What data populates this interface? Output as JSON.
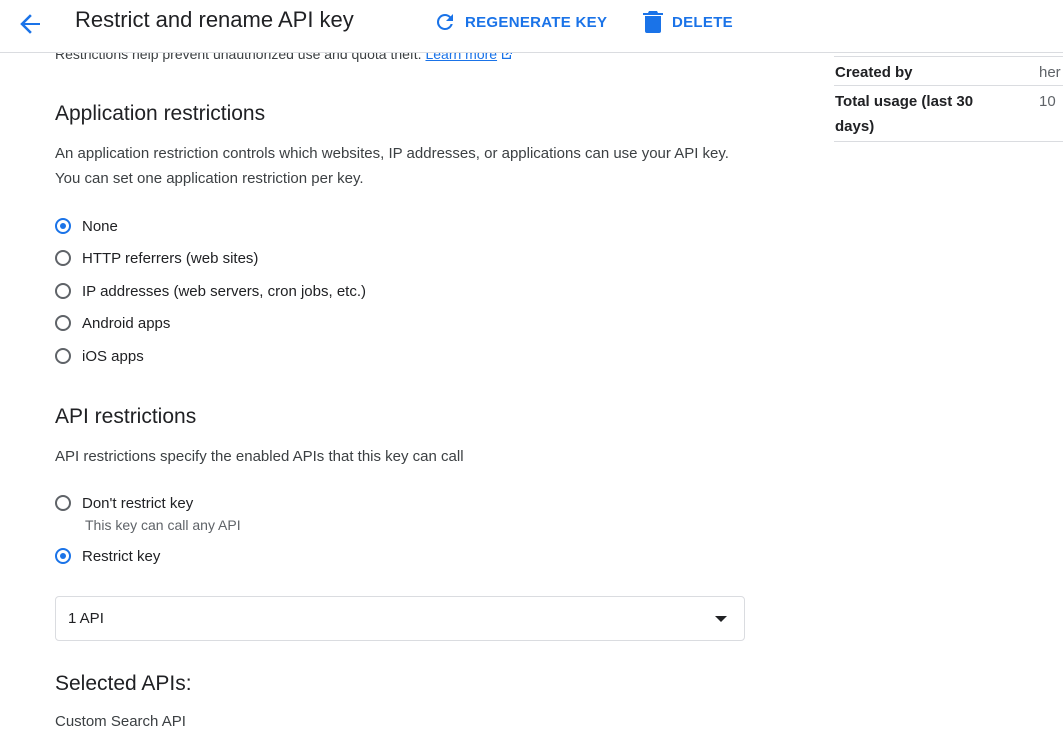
{
  "header": {
    "title": "Restrict and rename API key",
    "regenerate_label": "REGENERATE KEY",
    "delete_label": "DELETE"
  },
  "intro": {
    "text": "Restrictions help prevent unauthorized use and quota theft.",
    "link": "Learn more"
  },
  "application_restrictions": {
    "title": "Application restrictions",
    "description": "An application restriction controls which websites, IP addresses, or applications can use your API key. You can set one application restriction per key.",
    "options": [
      {
        "label": "None",
        "selected": true
      },
      {
        "label": "HTTP referrers (web sites)",
        "selected": false
      },
      {
        "label": "IP addresses (web servers, cron jobs, etc.)",
        "selected": false
      },
      {
        "label": "Android apps",
        "selected": false
      },
      {
        "label": "iOS apps",
        "selected": false
      }
    ]
  },
  "api_restrictions": {
    "title": "API restrictions",
    "description": "API restrictions specify the enabled APIs that this key can call",
    "options": [
      {
        "label": "Don't restrict key",
        "sublabel": "This key can call any API",
        "selected": false
      },
      {
        "label": "Restrict key",
        "selected": true
      }
    ],
    "select_value": "1 API",
    "selected_title": "Selected APIs:",
    "selected_items": [
      "Custom Search API"
    ]
  },
  "side_panel": {
    "created_by_label": "Created by",
    "created_by_value": "her",
    "usage_label": "Total usage (last 30 days)",
    "usage_value": "10"
  },
  "icons": {
    "back": "arrow-back-icon",
    "regenerate": "refresh-icon",
    "delete": "trash-icon",
    "external": "external-link-icon",
    "dropdown": "caret-down-icon"
  },
  "colors": {
    "accent": "#1a73e8",
    "divider": "#dadce0",
    "text": "#202124",
    "secondary_text": "#5f6368"
  }
}
